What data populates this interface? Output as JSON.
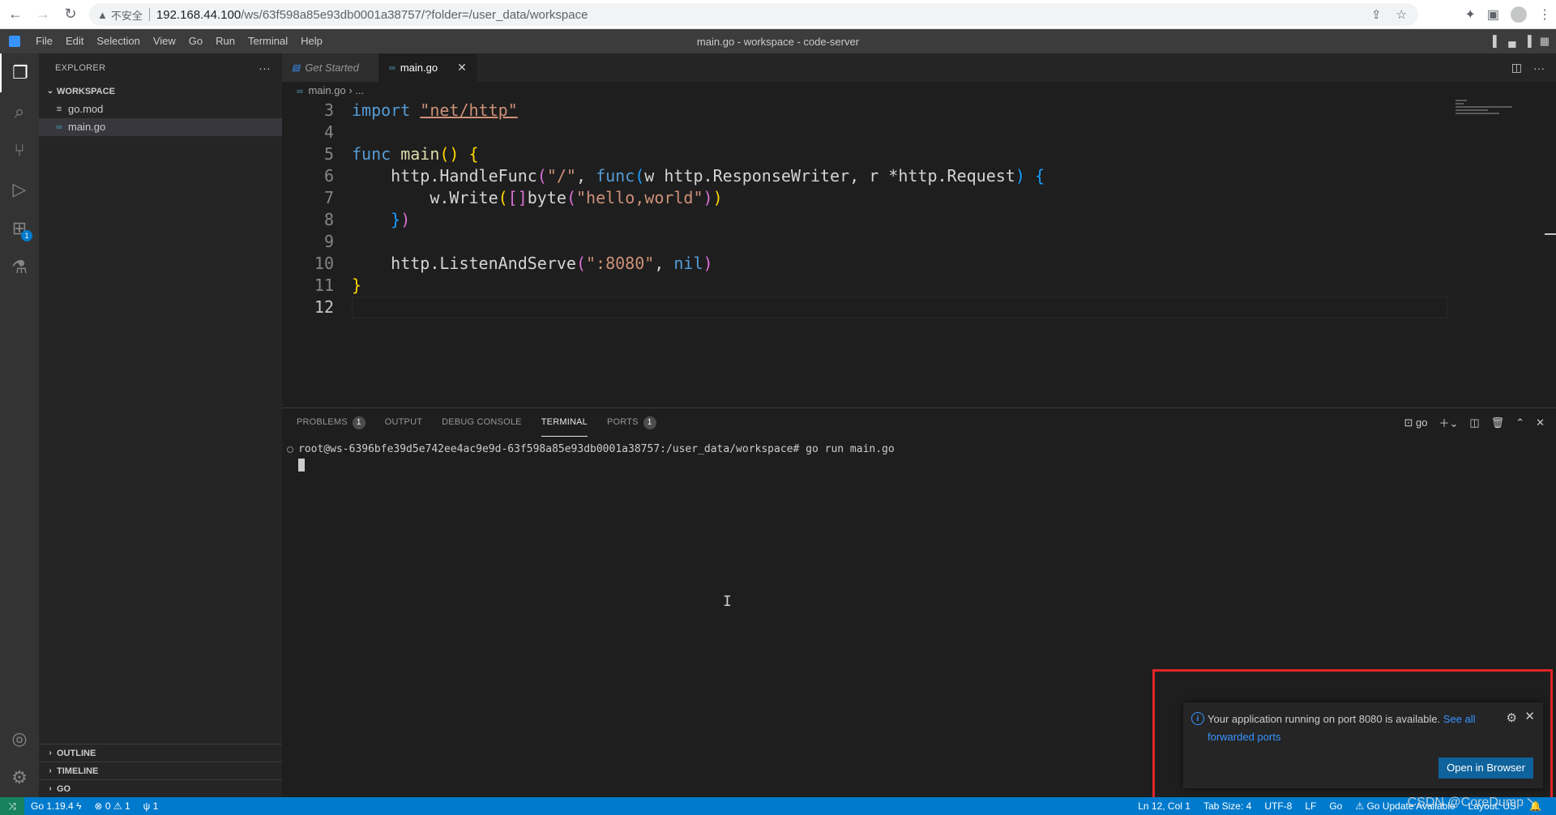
{
  "browser": {
    "warning_label": "不安全",
    "url_host": "192.168.44.100",
    "url_path": "/ws/63f598a85e93db0001a38757/?folder=/user_data/workspace"
  },
  "menu": [
    "File",
    "Edit",
    "Selection",
    "View",
    "Go",
    "Run",
    "Terminal",
    "Help"
  ],
  "window_title": "main.go - workspace - code-server",
  "activity": {
    "extensions_badge": "1"
  },
  "sidebar": {
    "title": "EXPLORER",
    "more": "···",
    "workspace_label": "WORKSPACE",
    "files": [
      "go.mod",
      "main.go"
    ],
    "outline": "OUTLINE",
    "timeline": "TIMELINE",
    "go": "GO"
  },
  "tabs": [
    {
      "label": "Get Started"
    },
    {
      "label": "main.go"
    }
  ],
  "breadcrumb": {
    "file": "main.go",
    "rest": "..."
  },
  "editor": {
    "line_numbers": [
      "3",
      "4",
      "5",
      "6",
      "7",
      "8",
      "9",
      "10",
      "11",
      "12"
    ],
    "tokens": {
      "import_kw": "import",
      "import_str": "\"net/http\"",
      "func_kw": "func",
      "main_fn": "main",
      "l6_a": "http.HandleFunc",
      "l6_str": "\"/\"",
      "l6_func": "func",
      "l6_params": "w http.ResponseWriter, r *http.Request",
      "l7_a": "w.Write",
      "l7_byte": "byte",
      "l7_str": "\"hello,world\"",
      "l10_a": "http.ListenAndServe",
      "l10_str": "\":8080\"",
      "l10_nil": "nil"
    }
  },
  "panel": {
    "tabs": [
      {
        "label": "PROBLEMS",
        "badge": "1"
      },
      {
        "label": "OUTPUT"
      },
      {
        "label": "DEBUG CONSOLE"
      },
      {
        "label": "TERMINAL"
      },
      {
        "label": "PORTS",
        "badge": "1"
      }
    ],
    "terminal_name": "go",
    "terminal_line": "root@ws-6396bfe39d5e742ee4ac9e9d-63f598a85e93db0001a38757:/user_data/workspace# go run main.go"
  },
  "notification": {
    "message": "Your application running on port 8080 is available.",
    "link": "See all forwarded ports",
    "button": "Open in Browser"
  },
  "status": {
    "go_version": "Go 1.19.4",
    "errors": "0",
    "warnings": "1",
    "ports": "1",
    "position": "Ln 12, Col 1",
    "tab_size": "Tab Size: 4",
    "encoding": "UTF-8",
    "eol": "LF",
    "language": "Go",
    "go_update": "Go Update Available",
    "layout": "Layout: US"
  },
  "watermark": "CSDN @CoreDump丶",
  "colors": {
    "statusbar": "#007acc",
    "accent_link": "#3794ff",
    "highlight_box": "#e0252a"
  }
}
